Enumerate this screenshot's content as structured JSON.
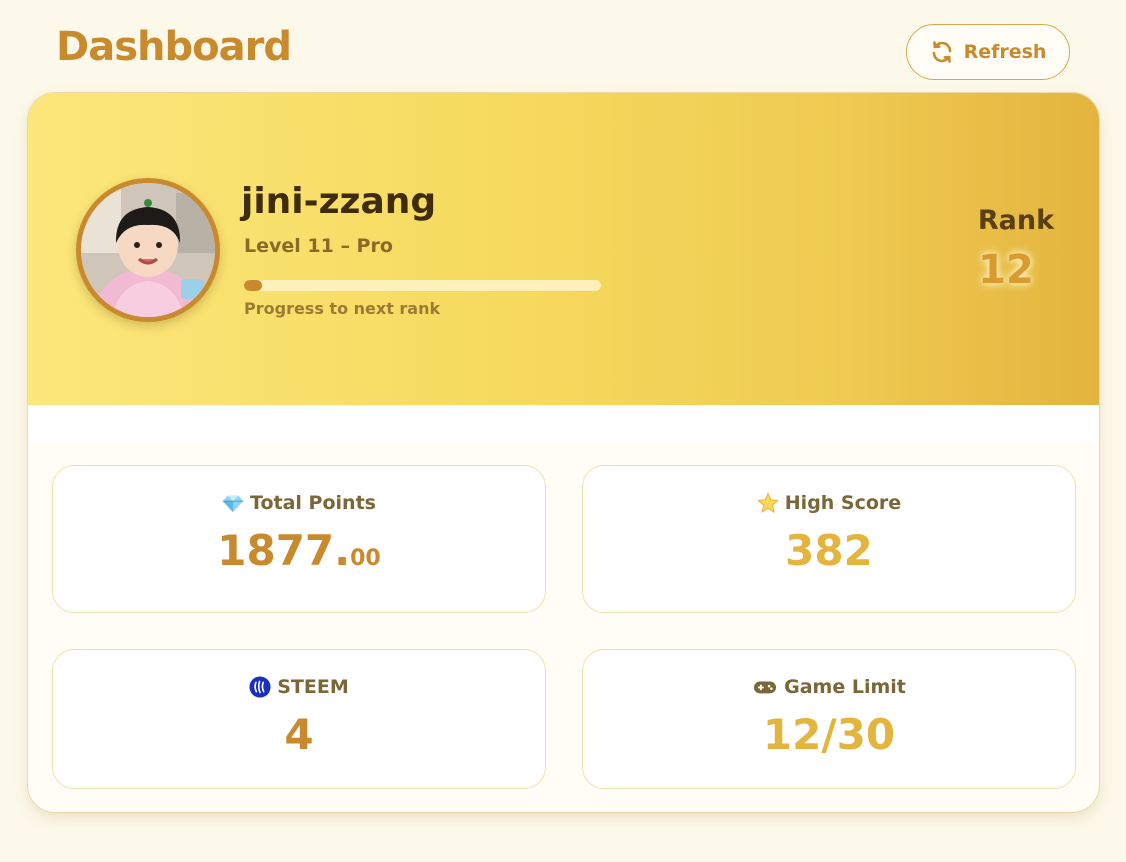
{
  "header": {
    "title": "Dashboard",
    "refresh_label": "Refresh"
  },
  "profile": {
    "username": "jini-zzang",
    "level": "Level 11 – Pro",
    "progress_label": "Progress to next rank",
    "progress_fraction": 0.05,
    "rank_label": "Rank",
    "rank_value": "12"
  },
  "stats": {
    "total_points": {
      "label": "Total Points",
      "value_int": "1877.",
      "value_dec": "00",
      "icon": "gem-icon"
    },
    "high_score": {
      "label": "High Score",
      "value": "382",
      "icon": "star-icon"
    },
    "steem": {
      "label": "STEEM",
      "value": "4",
      "icon": "steem-icon"
    },
    "game_limit": {
      "label": "Game Limit",
      "value": "12/30",
      "icon": "gamepad-icon"
    }
  },
  "colors": {
    "accent": "#c98a2e",
    "gold": "#e3b43e",
    "background": "#fdf9ea"
  }
}
